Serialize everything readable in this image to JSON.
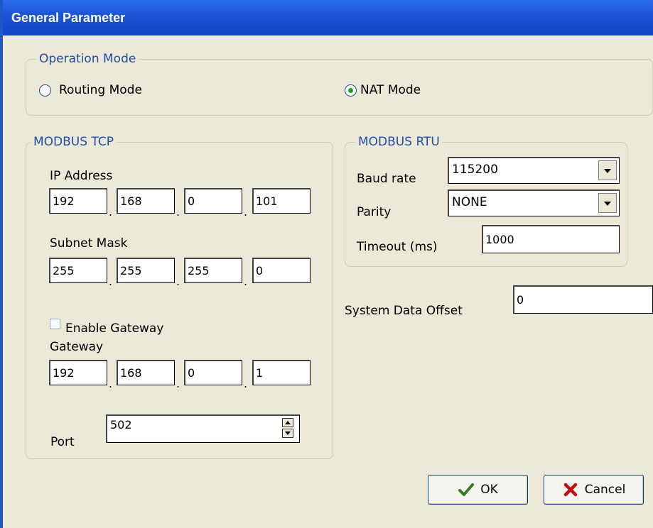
{
  "window": {
    "title": "General Parameter"
  },
  "operation_mode": {
    "legend": "Operation Mode",
    "options": [
      {
        "label": "Routing Mode",
        "selected": false
      },
      {
        "label": "NAT Mode",
        "selected": true
      }
    ]
  },
  "modbus_tcp": {
    "legend": "MODBUS TCP",
    "ip_label": "IP Address",
    "ip": [
      "192",
      "168",
      "0",
      "101"
    ],
    "subnet_label": "Subnet Mask",
    "subnet": [
      "255",
      "255",
      "255",
      "0"
    ],
    "enable_gateway_label": "Enable Gateway",
    "enable_gateway_checked": false,
    "gateway_label": "Gateway",
    "gateway": [
      "192",
      "168",
      "0",
      "1"
    ],
    "port_label": "Port",
    "port": "502"
  },
  "modbus_rtu": {
    "legend": "MODBUS RTU",
    "baud_label": "Baud rate",
    "baud": "115200",
    "parity_label": "Parity",
    "parity": "NONE",
    "timeout_label": "Timeout (ms)",
    "timeout": "1000"
  },
  "system_data_offset": {
    "label": "System Data Offset",
    "value": "0"
  },
  "buttons": {
    "ok": "OK",
    "cancel": "Cancel"
  },
  "icons": {
    "ok": "checkmark-icon",
    "cancel": "x-icon"
  },
  "colors": {
    "titlebar": "#1c56d6",
    "legend": "#1f4ea6",
    "ok_icon": "#2f7d1f",
    "cancel_icon": "#c01010"
  }
}
